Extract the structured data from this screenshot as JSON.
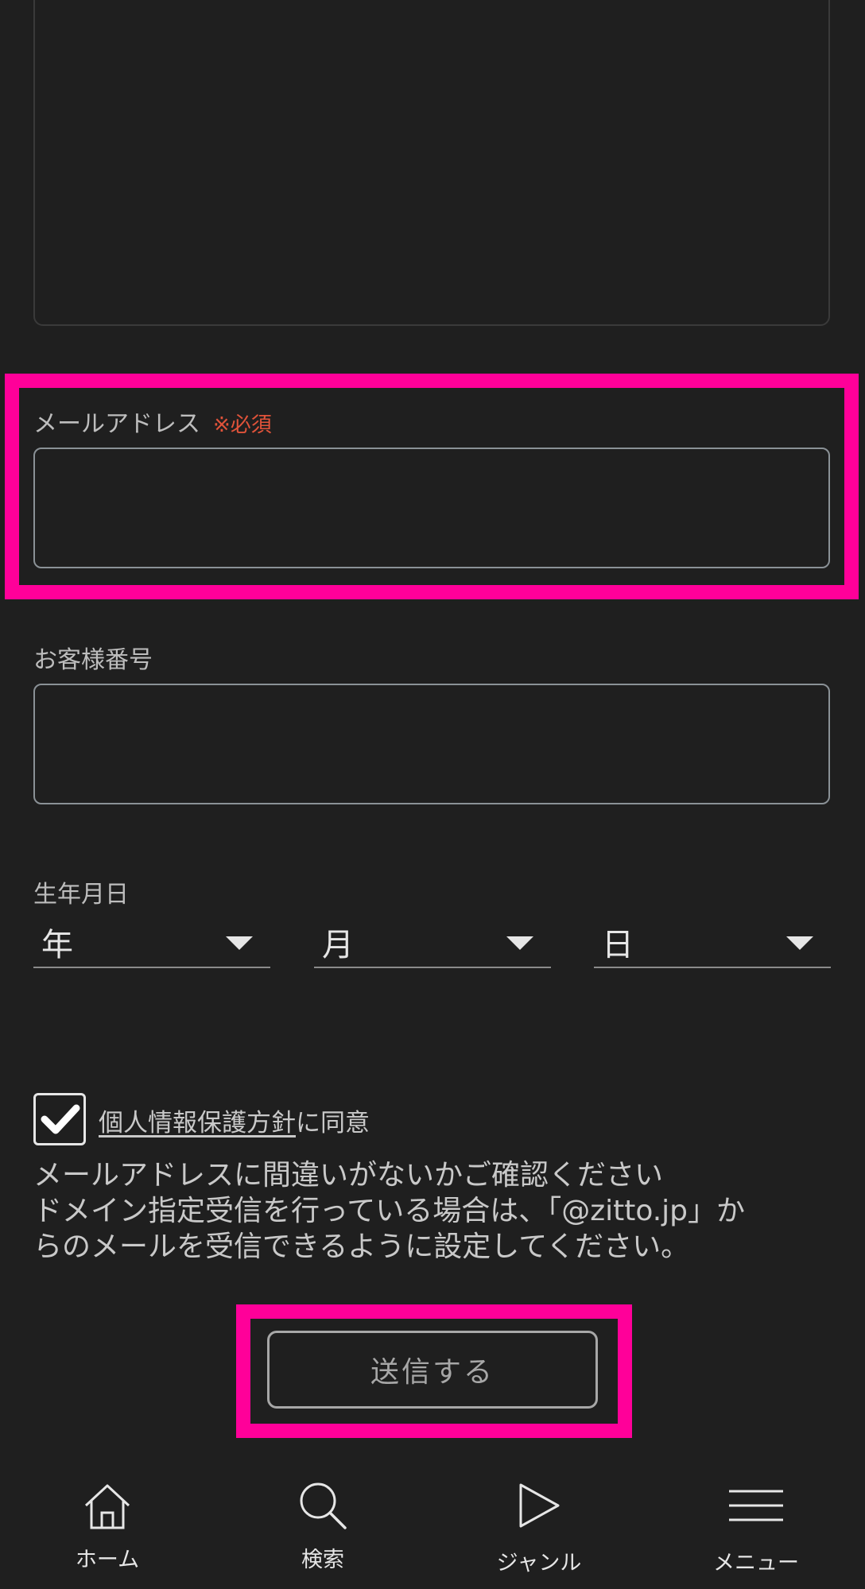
{
  "form": {
    "email_label": "メールアドレス",
    "required_mark": "※必須",
    "customer_number_label": "お客様番号",
    "birthdate_label": "生年月日",
    "year_value": "年",
    "month_value": "月",
    "day_value": "日",
    "consent_link": "個人情報保護方針",
    "consent_suffix": "に同意",
    "notice_lines": [
      "メールアドレスに間違いがないかご確認ください",
      "ドメイン指定受信を行っている場合は、「@zitto.jp」か",
      "らのメールを受信できるように設定してください。"
    ],
    "submit_label": "送信する",
    "consent_checked": true
  },
  "tabbar": {
    "home": "ホーム",
    "search": "検索",
    "genre": "ジャンル",
    "menu": "メニュー"
  },
  "colors": {
    "background": "#1f1f1f",
    "highlight": "#ff0099",
    "required": "#e0533a"
  }
}
